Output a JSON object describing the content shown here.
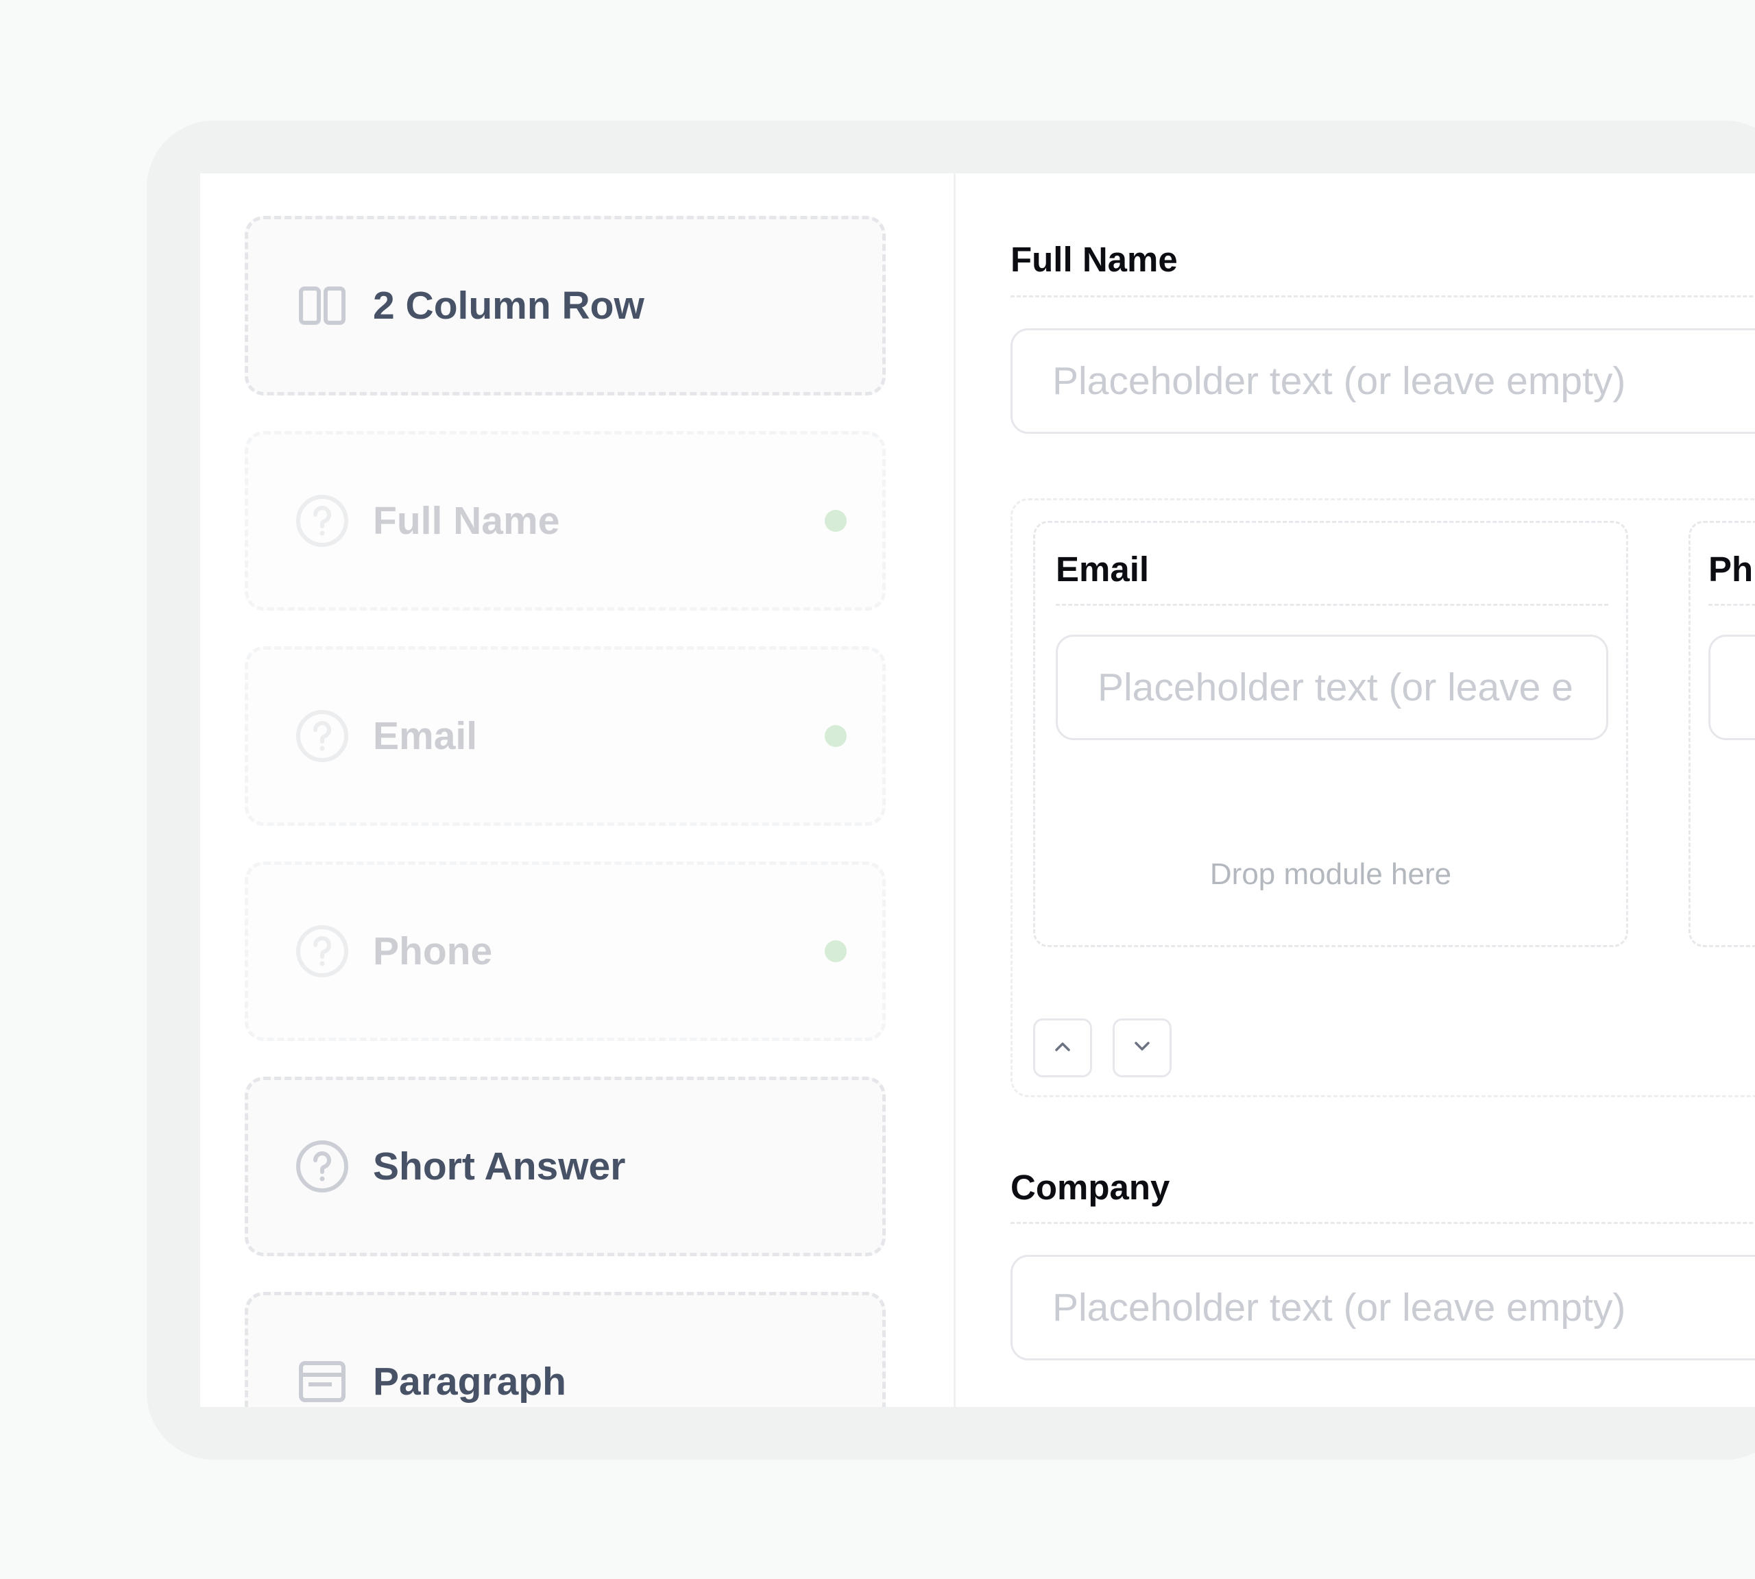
{
  "sidebar": {
    "modules": [
      {
        "label": "2 Column Row",
        "icon": "columns-icon",
        "state": "active"
      },
      {
        "label": "Full Name",
        "icon": "question-circle-icon",
        "state": "used"
      },
      {
        "label": "Email",
        "icon": "question-circle-icon",
        "state": "used"
      },
      {
        "label": "Phone",
        "icon": "question-circle-icon",
        "state": "used"
      },
      {
        "label": "Short Answer",
        "icon": "question-circle-icon",
        "state": "active"
      },
      {
        "label": "Paragraph",
        "icon": "paragraph-icon",
        "state": "active"
      }
    ]
  },
  "canvas": {
    "full_name": {
      "label": "Full Name",
      "placeholder": "Placeholder text (or leave empty)"
    },
    "row": {
      "left": {
        "label": "Email",
        "placeholder": "Placeholder text (or leave e",
        "drop_hint": "Drop module here"
      },
      "right": {
        "label": "Ph"
      }
    },
    "company": {
      "label": "Company",
      "placeholder": "Placeholder text (or leave empty)"
    }
  },
  "colors": {
    "accent_text": "#475266",
    "used_dot": "#d7ecd7",
    "placeholder": "#c9ccd2",
    "label": "#0b0d12"
  }
}
